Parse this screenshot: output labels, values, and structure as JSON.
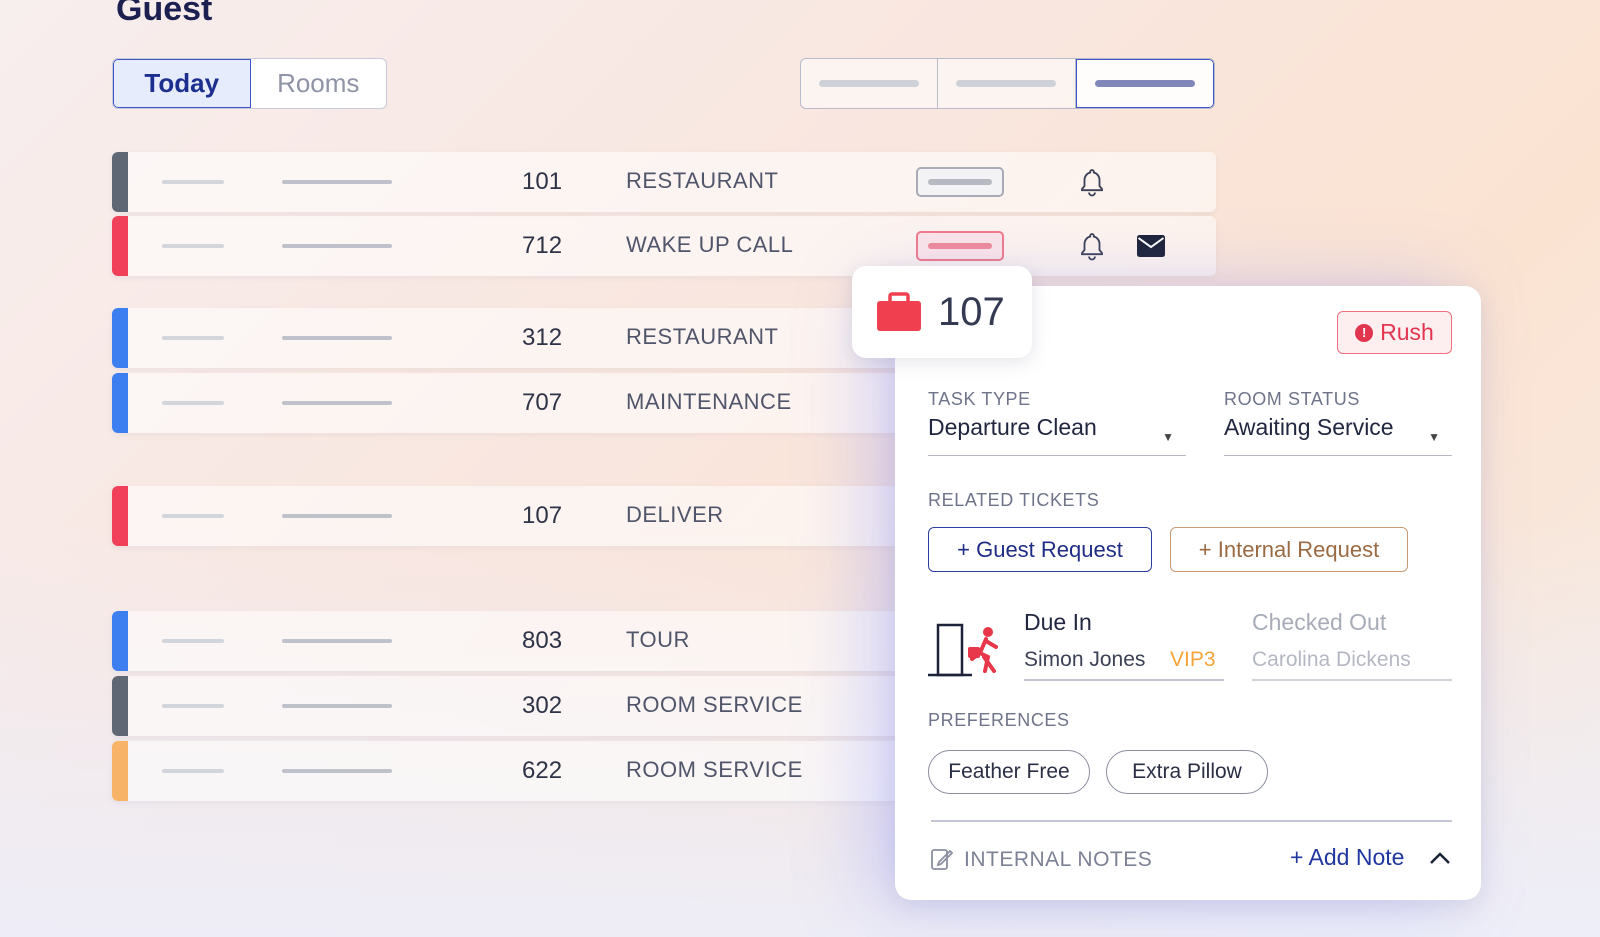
{
  "page": {
    "title": "Guest"
  },
  "tabs": [
    {
      "label": "Today",
      "active": true
    },
    {
      "label": "Rooms",
      "active": false
    }
  ],
  "view_switch": {
    "segments": 3,
    "active_index": 2
  },
  "colors": {
    "stripe_gray": "#5f6674",
    "stripe_red": "#f0405a",
    "stripe_blue": "#3d7ef0",
    "stripe_orange": "#f7b468",
    "accent": "#2236a0",
    "rush": "#e23650",
    "vip": "#f4a43a"
  },
  "rows": [
    {
      "number": "101",
      "label": "RESTAURANT",
      "stripe": "#5f6674",
      "pill": "gray",
      "bell": true,
      "mail": false
    },
    {
      "number": "712",
      "label": "WAKE UP CALL",
      "stripe": "#f0405a",
      "pill": "red",
      "bell": true,
      "mail": true
    },
    {
      "number": "312",
      "label": "RESTAURANT",
      "stripe": "#3d7ef0"
    },
    {
      "number": "707",
      "label": "MAINTENANCE",
      "stripe": "#3d7ef0"
    },
    {
      "number": "107",
      "label": "DELIVER",
      "stripe": "#f0405a"
    },
    {
      "number": "803",
      "label": "TOUR",
      "stripe": "#3d7ef0"
    },
    {
      "number": "302",
      "label": "ROOM SERVICE",
      "stripe": "#5f6674"
    },
    {
      "number": "622",
      "label": "ROOM SERVICE",
      "stripe": "#f7b468"
    }
  ],
  "card": {
    "room_icon": "briefcase-icon",
    "room_number": "107",
    "rush_label": "Rush",
    "task_type_caption": "TASK TYPE",
    "task_type_value": "Departure Clean",
    "room_status_caption": "ROOM STATUS",
    "room_status_value": "Awaiting Service",
    "related_caption": "RELATED TICKETS",
    "guest_request_label": "+ Guest Request",
    "internal_request_label": "+ Internal Request",
    "due_in_title": "Due In",
    "due_in_name": "Simon Jones",
    "due_in_badge": "VIP3",
    "checked_out_title": "Checked Out",
    "checked_out_name": "Carolina Dickens",
    "preferences_caption": "PREFERENCES",
    "preferences": [
      "Feather Free",
      "Extra Pillow"
    ],
    "notes_caption": "INTERNAL NOTES",
    "add_note_label": "+ Add Note"
  }
}
